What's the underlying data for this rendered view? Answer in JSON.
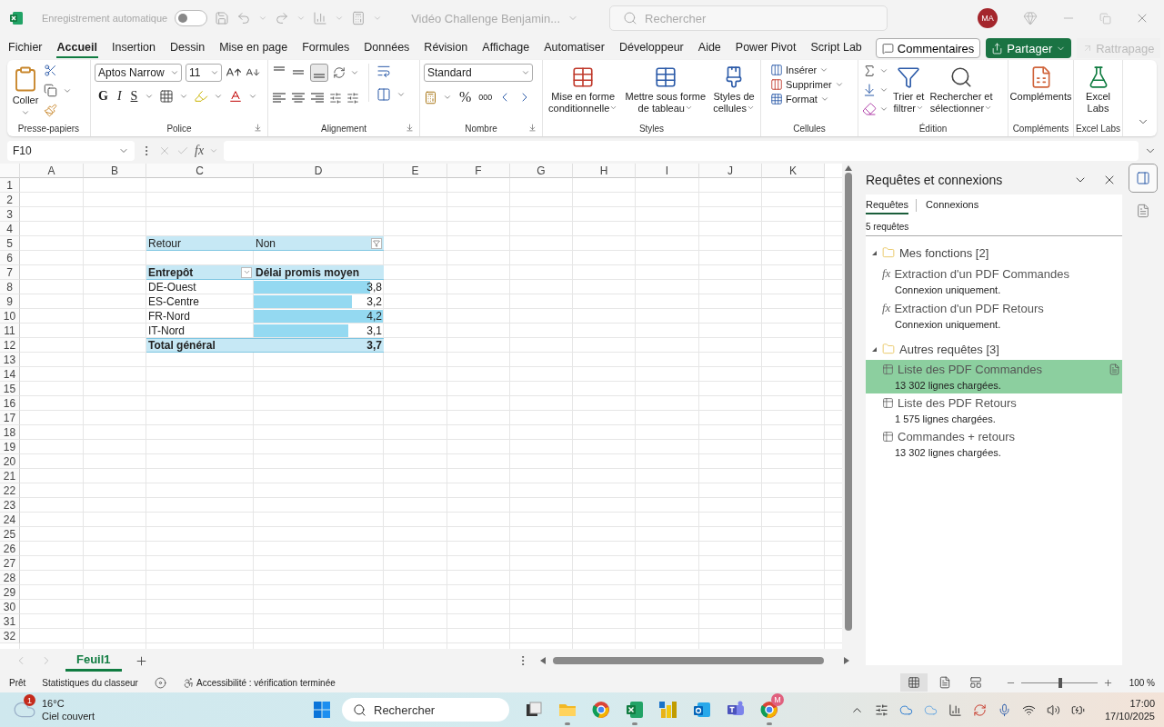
{
  "title_bar": {
    "autosave_label": "Enregistrement automatique",
    "autosave_on": false,
    "document": "Vidéo Challenge Benjamin...",
    "search_placeholder": "Rechercher",
    "avatar": "MA"
  },
  "menu": {
    "tabs": [
      {
        "label": "Fichier",
        "selected": false
      },
      {
        "label": "Accueil",
        "selected": true
      },
      {
        "label": "Insertion",
        "selected": false
      },
      {
        "label": "Dessin",
        "selected": false
      },
      {
        "label": "Mise en page",
        "selected": false
      },
      {
        "label": "Formules",
        "selected": false
      },
      {
        "label": "Données",
        "selected": false
      },
      {
        "label": "Révision",
        "selected": false
      },
      {
        "label": "Affichage",
        "selected": false
      },
      {
        "label": "Automatiser",
        "selected": false
      },
      {
        "label": "Développeur",
        "selected": false
      },
      {
        "label": "Aide",
        "selected": false
      },
      {
        "label": "Power Pivot",
        "selected": false
      },
      {
        "label": "Script Lab",
        "selected": false
      }
    ],
    "comments": "Commentaires",
    "share": "Partager",
    "catch_up": "Rattrapage"
  },
  "ribbon": {
    "clipboard": {
      "title": "Presse-papiers",
      "paste": "Coller"
    },
    "font": {
      "title": "Police",
      "name": "Aptos Narrow",
      "size": "11",
      "bold": "G",
      "italic": "I",
      "underline": "S"
    },
    "alignment": {
      "title": "Alignement"
    },
    "number": {
      "title": "Nombre",
      "format": "Standard",
      "percent": "%",
      "thousands": "000"
    },
    "styles": {
      "title": "Styles",
      "conditional": "Mise en forme\nconditionnelle",
      "as_table": "Mettre sous forme\nde tableau",
      "cell_styles": "Styles de\ncellules"
    },
    "cells": {
      "title": "Cellules",
      "insert": "Insérer",
      "delete": "Supprimer",
      "format": "Format"
    },
    "editing": {
      "title": "Édition",
      "sort": "Trier et\nfiltrer",
      "find": "Rechercher et\nsélectionner"
    },
    "addins": {
      "title": "Compléments",
      "addins": "Compléments"
    },
    "labs": {
      "title": "Excel Labs",
      "labs": "Excel\nLabs"
    }
  },
  "formula_bar": {
    "name_box": "F10",
    "fx": "fx"
  },
  "sheet": {
    "columns": [
      "A",
      "B",
      "C",
      "D",
      "E",
      "F",
      "G",
      "H",
      "I",
      "J",
      "K"
    ],
    "rows": [
      "1",
      "2",
      "3",
      "4",
      "5",
      "6",
      "7",
      "8",
      "9",
      "10",
      "11",
      "12",
      "13",
      "14",
      "15",
      "16",
      "17",
      "18",
      "19",
      "20",
      "21",
      "22",
      "23",
      "24",
      "25",
      "26",
      "27",
      "28",
      "29",
      "30",
      "31",
      "32"
    ],
    "pivot": {
      "filter_label": "Retour",
      "filter_value": "Non",
      "headers": [
        "Entrepôt",
        "Délai promis moyen"
      ],
      "rows": [
        {
          "label": "DE-Ouest",
          "value": "3,8"
        },
        {
          "label": "ES-Centre",
          "value": "3,2"
        },
        {
          "label": "FR-Nord",
          "value": "4,2"
        },
        {
          "label": "IT-Nord",
          "value": "3,1"
        }
      ],
      "total_label": "Total général",
      "total_value": "3,7"
    }
  },
  "sheet_tabs": [
    {
      "label": "Feuil1",
      "selected": true
    }
  ],
  "panel": {
    "title": "Requêtes et connexions",
    "tabs": [
      {
        "label": "Requêtes",
        "selected": true
      },
      {
        "label": "Connexions",
        "selected": false
      }
    ],
    "count": "5 requêtes",
    "groups": [
      {
        "label": "Mes fonctions [2]",
        "expanded": true,
        "children": [
          {
            "kind": "function",
            "glyph": "fx",
            "name": "Extraction d'un PDF Commandes",
            "status": "Connexion uniquement.",
            "selected": false
          },
          {
            "kind": "function",
            "glyph": "fx",
            "name": "Extraction d'un PDF Retours",
            "status": "Connexion uniquement.",
            "selected": false
          }
        ]
      },
      {
        "label": "Autres requêtes [3]",
        "expanded": true,
        "children": [
          {
            "kind": "table",
            "name": "Liste des PDF Commandes",
            "status": "13 302 lignes chargées.",
            "selected": true
          },
          {
            "kind": "table",
            "name": "Liste des PDF Retours",
            "status": "1 575 lignes chargées.",
            "selected": false
          },
          {
            "kind": "table",
            "name": "Commandes + retours",
            "status": "13 302 lignes chargées.",
            "selected": false
          }
        ]
      }
    ]
  },
  "status_bar": {
    "ready": "Prêt",
    "stats": "Statistiques du classeur",
    "accessibility": "Accessibilité : vérification terminée",
    "views": [
      {
        "kind": "normal",
        "selected": true
      },
      {
        "kind": "page_layout",
        "selected": false
      },
      {
        "kind": "page_break",
        "selected": false
      }
    ],
    "zoom_slider": {
      "level": 0.49
    },
    "zoom": "100 %"
  },
  "taskbar": {
    "weather_badge": "1",
    "temperature": "16°C",
    "weather": "Ciel couvert",
    "search_placeholder": "Rechercher",
    "apps": [
      {
        "kind": "task_view",
        "running": false
      },
      {
        "kind": "explorer",
        "running": true
      },
      {
        "kind": "browser",
        "running": false
      },
      {
        "kind": "excel",
        "running": true
      },
      {
        "kind": "powerbi",
        "running": false
      },
      {
        "kind": "outlook",
        "running": false
      },
      {
        "kind": "teams",
        "running": false
      },
      {
        "kind": "browser_profile",
        "running": true,
        "badge": "M"
      }
    ],
    "time": "17:00",
    "date": "17/10/2025"
  }
}
